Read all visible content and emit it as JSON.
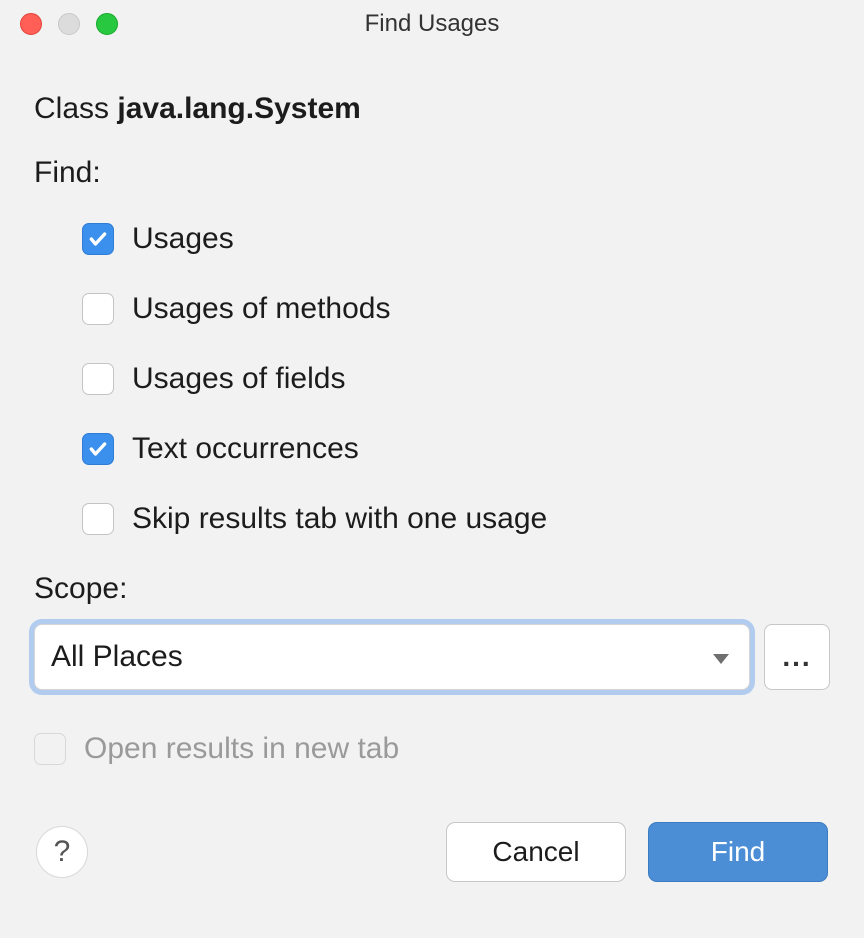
{
  "window": {
    "title": "Find Usages"
  },
  "header": {
    "prefix": "Class ",
    "name": "java.lang.System"
  },
  "find": {
    "label": "Find:",
    "options": [
      {
        "label": "Usages",
        "checked": true
      },
      {
        "label": "Usages of methods",
        "checked": false
      },
      {
        "label": "Usages of fields",
        "checked": false
      },
      {
        "label": "Text occurrences",
        "checked": true
      },
      {
        "label": "Skip results tab with one usage",
        "checked": false
      }
    ]
  },
  "scope": {
    "label": "Scope:",
    "selected": "All Places",
    "more": "..."
  },
  "openInNewTab": {
    "label": "Open results in new tab",
    "checked": false,
    "disabled": true
  },
  "footer": {
    "help": "?",
    "cancel": "Cancel",
    "find": "Find"
  }
}
